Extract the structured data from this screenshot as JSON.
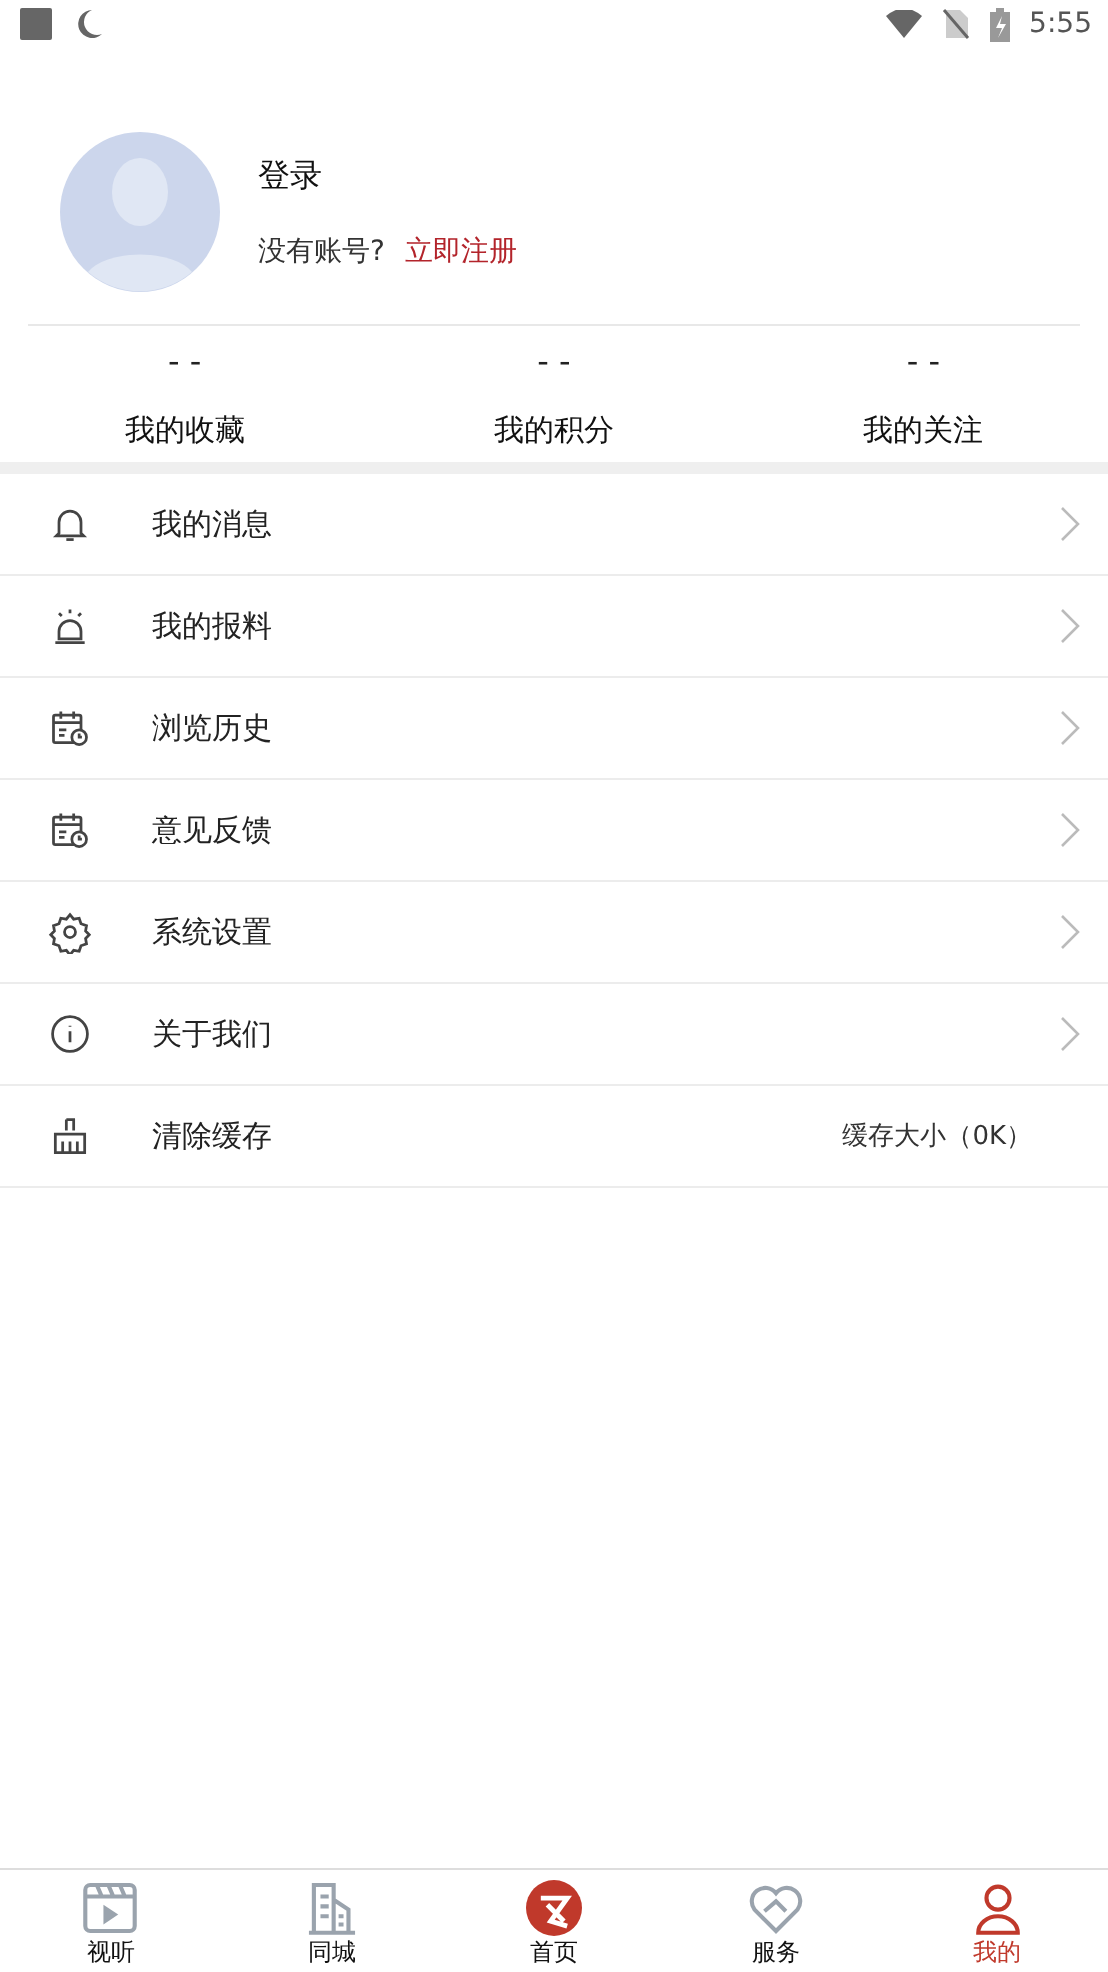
{
  "status_bar": {
    "time": "5:55"
  },
  "profile": {
    "title": "登录",
    "prompt": "没有账号?",
    "register_link": "立即注册"
  },
  "stats": [
    {
      "value": "- -",
      "label": "我的收藏"
    },
    {
      "value": "- -",
      "label": "我的积分"
    },
    {
      "value": "- -",
      "label": "我的关注"
    }
  ],
  "menu": [
    {
      "kind": "bell",
      "label": "我的消息",
      "chevron": true
    },
    {
      "kind": "alarm",
      "label": "我的报料",
      "chevron": true
    },
    {
      "kind": "calendar",
      "label": "浏览历史",
      "chevron": true
    },
    {
      "kind": "calendar",
      "label": "意见反馈",
      "chevron": true
    },
    {
      "kind": "gear",
      "label": "系统设置",
      "chevron": true
    },
    {
      "kind": "info",
      "label": "关于我们",
      "chevron": true
    },
    {
      "kind": "broom",
      "label": "清除缓存",
      "chevron": false,
      "detail": "缓存大小（0K）"
    }
  ],
  "tab_bar": [
    {
      "kind": "video",
      "label": "视听",
      "selected": false
    },
    {
      "kind": "building",
      "label": "同城",
      "selected": false
    },
    {
      "kind": "home",
      "label": "首页",
      "selected": false
    },
    {
      "kind": "heart",
      "label": "服务",
      "selected": false
    },
    {
      "kind": "person",
      "label": "我的",
      "selected": true
    }
  ]
}
